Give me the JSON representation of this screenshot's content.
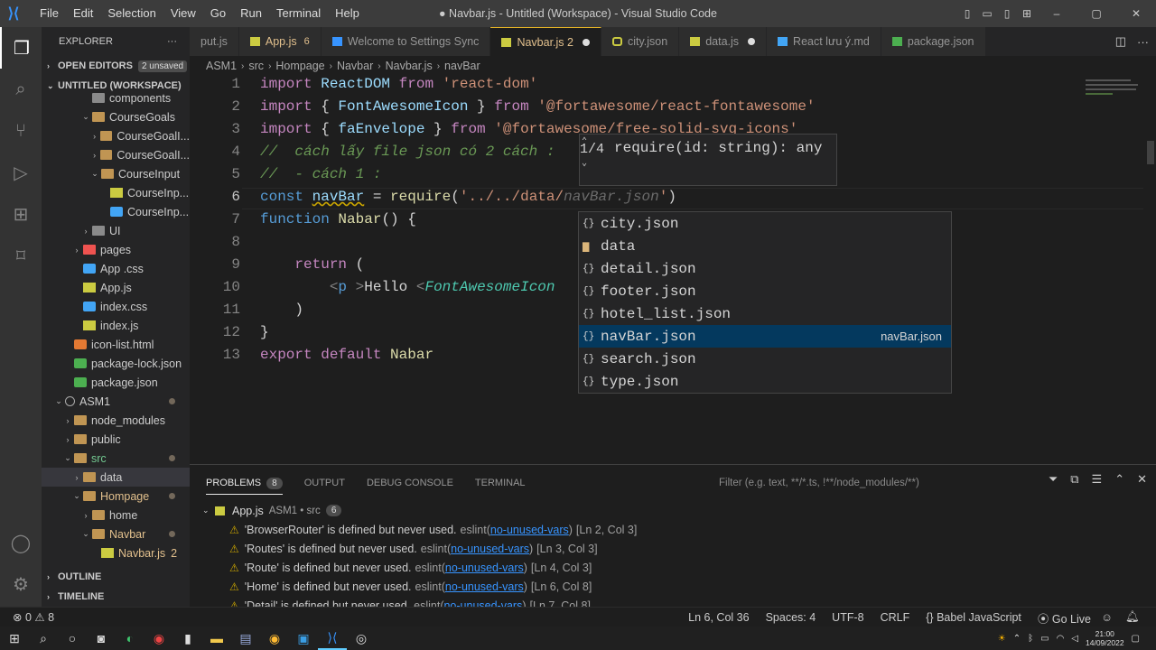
{
  "menu": [
    "File",
    "Edit",
    "Selection",
    "View",
    "Go",
    "Run",
    "Terminal",
    "Help"
  ],
  "window_title": "● Navbar.js - Untitled (Workspace) - Visual Studio Code",
  "explorer": {
    "title": "EXPLORER",
    "open_editors": "OPEN EDITORS",
    "unsaved": "2 unsaved",
    "workspace": "UNTITLED (WORKSPACE)",
    "outline": "OUTLINE",
    "timeline": "TIMELINE",
    "tree": [
      {
        "label": "components",
        "indent": 3,
        "type": "folderg",
        "chev": ""
      },
      {
        "label": "CourseGoals",
        "indent": 3,
        "type": "folder",
        "chev": "⌄"
      },
      {
        "label": "CourseGoalI...",
        "indent": 4,
        "type": "folder",
        "chev": "›"
      },
      {
        "label": "CourseGoalI...",
        "indent": 4,
        "type": "folder",
        "chev": "›"
      },
      {
        "label": "CourseInput",
        "indent": 4,
        "type": "folder",
        "chev": "⌄"
      },
      {
        "label": "CourseInp...",
        "indent": 5,
        "type": "js",
        "chev": ""
      },
      {
        "label": "CourseInp...",
        "indent": 5,
        "type": "css",
        "chev": ""
      },
      {
        "label": "UI",
        "indent": 3,
        "type": "folderg",
        "chev": "›"
      },
      {
        "label": "pages",
        "indent": 2,
        "type": "pages",
        "chev": "›"
      },
      {
        "label": "App .css",
        "indent": 2,
        "type": "css",
        "chev": ""
      },
      {
        "label": "App.js",
        "indent": 2,
        "type": "js",
        "chev": ""
      },
      {
        "label": "index.css",
        "indent": 2,
        "type": "css",
        "chev": ""
      },
      {
        "label": "index.js",
        "indent": 2,
        "type": "js",
        "chev": ""
      },
      {
        "label": "icon-list.html",
        "indent": 1,
        "type": "html",
        "chev": ""
      },
      {
        "label": "package-lock.json",
        "indent": 1,
        "type": "green",
        "chev": ""
      },
      {
        "label": "package.json",
        "indent": 1,
        "type": "green",
        "chev": ""
      },
      {
        "label": "ASM1",
        "indent": 0,
        "type": "ring",
        "chev": "⌄",
        "dot": true
      },
      {
        "label": "node_modules",
        "indent": 1,
        "type": "folder",
        "chev": "›"
      },
      {
        "label": "public",
        "indent": 1,
        "type": "folder",
        "chev": "›"
      },
      {
        "label": "src",
        "indent": 1,
        "type": "folder",
        "chev": "⌄",
        "dot": true,
        "color": "#73c991"
      },
      {
        "label": "data",
        "indent": 2,
        "type": "folder",
        "chev": "›",
        "sel": true
      },
      {
        "label": "Hompage",
        "indent": 2,
        "type": "folder",
        "chev": "⌄",
        "dot": true,
        "color": "#e2c08d"
      },
      {
        "label": "home",
        "indent": 3,
        "type": "folder",
        "chev": "›"
      },
      {
        "label": "Navbar",
        "indent": 3,
        "type": "folder",
        "chev": "⌄",
        "dot": true,
        "color": "#e2c08d"
      },
      {
        "label": "Navbar.js",
        "indent": 4,
        "type": "js",
        "chev": "",
        "num": "2",
        "color": "#e2c08d"
      }
    ]
  },
  "tabs": [
    {
      "label": "put.js",
      "icon": "",
      "extra": ""
    },
    {
      "label": "App.js",
      "icon": "js",
      "extra": "6",
      "color": "#e2c08d"
    },
    {
      "label": "Welcome to Settings Sync",
      "icon": "doc",
      "extra": ""
    },
    {
      "label": "Navbar.js 2",
      "icon": "js",
      "extra": "",
      "active": true,
      "modified": true,
      "color": "#e2c08d"
    },
    {
      "label": "city.json",
      "icon": "json",
      "extra": ""
    },
    {
      "label": "data.js",
      "icon": "js",
      "extra": "",
      "modified": true
    },
    {
      "label": "React lưu ý.md",
      "icon": "md",
      "extra": ""
    },
    {
      "label": "package.json",
      "icon": "green",
      "extra": ""
    }
  ],
  "breadcrumb": [
    "ASM1",
    "src",
    "Hompage",
    "Navbar",
    "Navbar.js",
    "navBar"
  ],
  "editor": {
    "line_numbers": [
      "1",
      "2",
      "3",
      "4",
      "5",
      "6",
      "7",
      "8",
      "9",
      "10",
      "11",
      "12",
      "13"
    ],
    "hover_text": "require(id: string): any",
    "hover_count": "1/4",
    "suggestions": [
      {
        "label": "city.json",
        "kind": "json"
      },
      {
        "label": "data",
        "kind": "folder"
      },
      {
        "label": "detail.json",
        "kind": "json"
      },
      {
        "label": "footer.json",
        "kind": "json"
      },
      {
        "label": "hotel_list.json",
        "kind": "json"
      },
      {
        "label": "navBar.json",
        "kind": "json",
        "selected": true,
        "detail": "navBar.json"
      },
      {
        "label": "search.json",
        "kind": "json"
      },
      {
        "label": "type.json",
        "kind": "json"
      }
    ]
  },
  "panel": {
    "tabs": [
      "PROBLEMS",
      "OUTPUT",
      "DEBUG CONSOLE",
      "TERMINAL"
    ],
    "problems_count": "8",
    "filter_placeholder": "Filter (e.g. text, **/*.ts, !**/node_modules/**)",
    "file": "App.js",
    "file_path": "ASM1 • src",
    "file_count": "6",
    "problems": [
      {
        "msg": "'BrowserRouter' is defined but never used.",
        "src": "eslint",
        "rule": "no-unused-vars",
        "loc": "[Ln 2, Col 3]"
      },
      {
        "msg": "'Routes' is defined but never used.",
        "src": "eslint",
        "rule": "no-unused-vars",
        "loc": "[Ln 3, Col 3]"
      },
      {
        "msg": "'Route' is defined but never used.",
        "src": "eslint",
        "rule": "no-unused-vars",
        "loc": "[Ln 4, Col 3]"
      },
      {
        "msg": "'Home' is defined but never used.",
        "src": "eslint",
        "rule": "no-unused-vars",
        "loc": "[Ln 6, Col 8]"
      },
      {
        "msg": "'Detail' is defined but never used.",
        "src": "eslint",
        "rule": "no-unused-vars",
        "loc": "[Ln 7, Col 8]"
      }
    ]
  },
  "status": {
    "errors": "0",
    "warnings": "8",
    "position": "Ln 6, Col 36",
    "spaces": "Spaces: 4",
    "encoding": "UTF-8",
    "eol": "CRLF",
    "language": "Babel JavaScript",
    "golive": "Go Live"
  },
  "taskbar": {
    "time": "21:00",
    "date": "14/09/2022"
  }
}
